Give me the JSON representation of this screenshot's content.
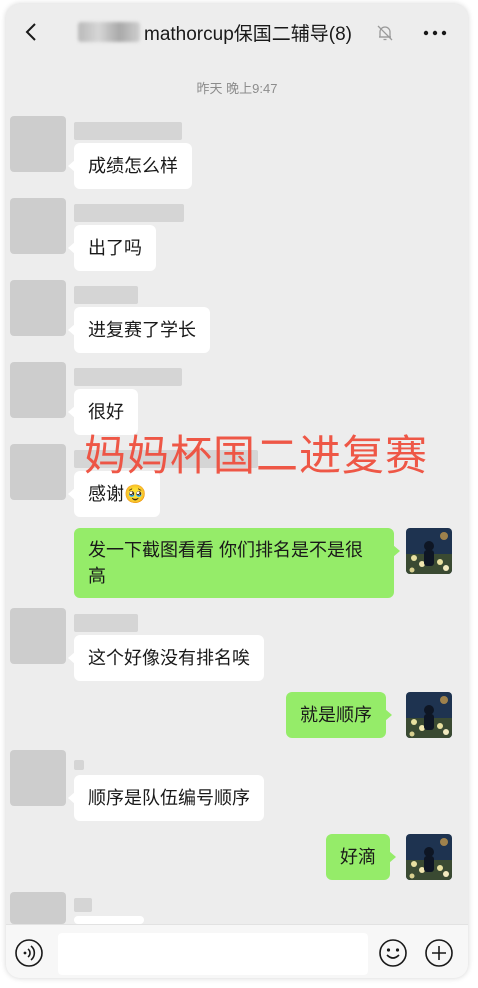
{
  "header": {
    "title": "mathorcup保国二辅导(8)",
    "back_icon": "chevron-left-icon",
    "mute_icon": "bell-off-icon",
    "more_icon": "more-horizontal-icon"
  },
  "time_label": "昨天 晚上9:47",
  "messages": [
    {
      "side": "left",
      "text": "成绩怎么样"
    },
    {
      "side": "left",
      "text": "出了吗"
    },
    {
      "side": "left",
      "text": "进复赛了学长"
    },
    {
      "side": "left",
      "text": "很好"
    },
    {
      "side": "left",
      "text": "感谢🥹"
    },
    {
      "side": "right",
      "text": "发一下截图看看 你们排名是不是很高"
    },
    {
      "side": "left",
      "text": "这个好像没有排名唉"
    },
    {
      "side": "right",
      "text": "就是顺序"
    },
    {
      "side": "left",
      "text": "顺序是队伍编号顺序"
    },
    {
      "side": "right",
      "text": "好滴"
    }
  ],
  "overlay_text": "妈妈杯国二进复赛",
  "input_bar": {
    "voice_icon": "voice-icon",
    "emoji_icon": "emoji-smile-icon",
    "plus_icon": "plus-circle-icon"
  },
  "colors": {
    "my_bubble": "#95ec69",
    "other_bubble": "#ffffff",
    "background": "#ededed",
    "overlay_text": "#ef4f3e"
  }
}
